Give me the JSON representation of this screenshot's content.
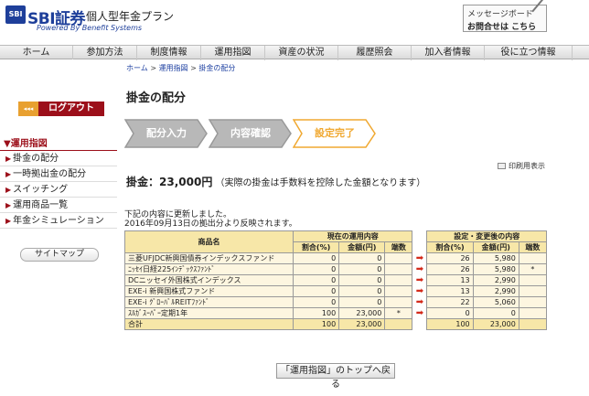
{
  "header": {
    "logo_mark": "SBI",
    "brand": "SBI証券",
    "product": "個人型年金プラン",
    "powered": "Powered By Benefit Systems",
    "message_board_line1": "メッセージボード",
    "message_board_line2": "お問合せは こちら"
  },
  "nav": [
    {
      "label": "ホーム"
    },
    {
      "label": "参加方法"
    },
    {
      "label": "制度情報"
    },
    {
      "label": "運用指図"
    },
    {
      "label": "資産の状況"
    },
    {
      "label": "履歴照会"
    },
    {
      "label": "加入者情報"
    },
    {
      "label": "役に立つ情報"
    }
  ],
  "breadcrumb": {
    "home": "ホーム",
    "sep1": ">",
    "mid": "運用指図",
    "sep2": ">",
    "current": "掛金の配分"
  },
  "sidebar": {
    "logout": "ログアウト",
    "logout_arrows": "◂◂◂",
    "menu_head": "運用指図",
    "items": [
      {
        "label": "掛金の配分"
      },
      {
        "label": "一時拠出金の配分"
      },
      {
        "label": "スイッチング"
      },
      {
        "label": "運用商品一覧"
      },
      {
        "label": "年金シミュレーション"
      }
    ],
    "sitemap": "サイトマップ"
  },
  "main": {
    "title": "掛金の配分",
    "steps": [
      {
        "label": "配分入力",
        "state": "done"
      },
      {
        "label": "内容確認",
        "state": "done"
      },
      {
        "label": "設定完了",
        "state": "current"
      }
    ],
    "print_label": "印刷用表示",
    "amount_label": "掛金：",
    "amount_value": "23,000円",
    "amount_note": "（実際の掛金は手数料を控除した金額となります）",
    "note_line1": "下記の内容に更新しました。",
    "note_line2": "2016年09月13日の拠出分より反映されます。",
    "back_button": "「運用指図」のトップへ戻る"
  },
  "table": {
    "h_product": "商品名",
    "h_current": "現在の運用内容",
    "h_new": "設定・変更後の内容",
    "h_ratio": "割合(%)",
    "h_amount": "金額(円)",
    "h_fraction": "端数",
    "arrow": "➡",
    "rows": [
      {
        "name": "三菱UFJDC新興国債券インデックスファンド",
        "cur_ratio": "0",
        "cur_amount": "0",
        "cur_frac": "",
        "new_ratio": "26",
        "new_amount": "5,980",
        "new_frac": ""
      },
      {
        "name": "ﾆｯｾｲ日経225ｲﾝﾃﾞｯｸｽﾌｧﾝﾄﾞ",
        "cur_ratio": "0",
        "cur_amount": "0",
        "cur_frac": "",
        "new_ratio": "26",
        "new_amount": "5,980",
        "new_frac": "*"
      },
      {
        "name": "DCニッセイ外国株式インデックス",
        "cur_ratio": "0",
        "cur_amount": "0",
        "cur_frac": "",
        "new_ratio": "13",
        "new_amount": "2,990",
        "new_frac": ""
      },
      {
        "name": "EXE-i 新興国株式ファンド",
        "cur_ratio": "0",
        "cur_amount": "0",
        "cur_frac": "",
        "new_ratio": "13",
        "new_amount": "2,990",
        "new_frac": ""
      },
      {
        "name": "EXE-i ｸﾞﾛｰﾊﾞﾙREITﾌｧﾝﾄﾞ",
        "cur_ratio": "0",
        "cur_amount": "0",
        "cur_frac": "",
        "new_ratio": "22",
        "new_amount": "5,060",
        "new_frac": ""
      },
      {
        "name": "ｽﾙｶﾞｽｰﾊﾟｰ定期1年",
        "cur_ratio": "100",
        "cur_amount": "23,000",
        "cur_frac": "*",
        "new_ratio": "0",
        "new_amount": "0",
        "new_frac": ""
      }
    ],
    "total": {
      "name": "合計",
      "cur_ratio": "100",
      "cur_amount": "23,000",
      "new_ratio": "100",
      "new_amount": "23,000"
    }
  },
  "colors": {
    "brand_blue": "#1e3f9a",
    "accent_red": "#9c0f1a",
    "step_done": "#b8b8b8",
    "step_current": "#f0a830",
    "table_header": "#f7e7a8",
    "table_cell": "#fdf6e0"
  }
}
